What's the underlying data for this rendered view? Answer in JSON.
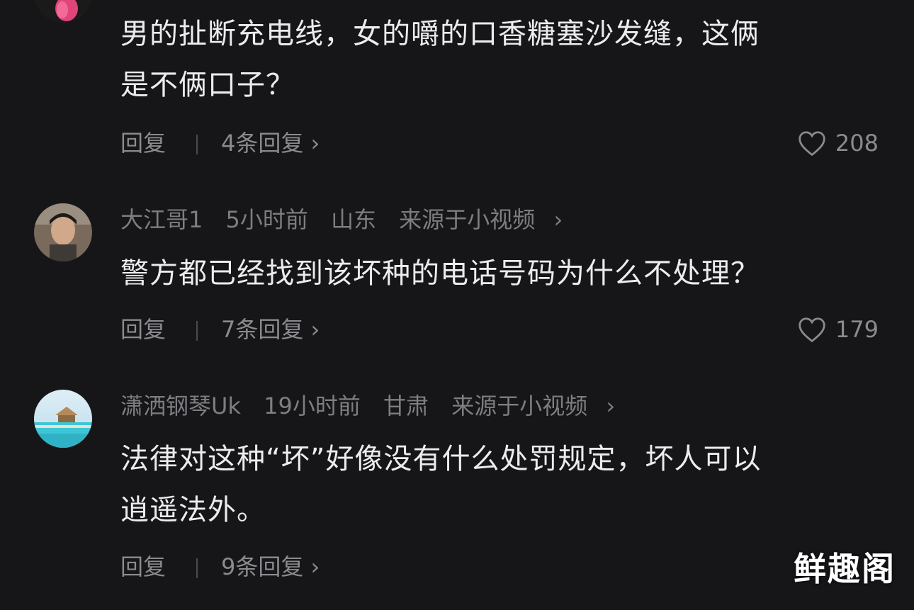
{
  "comments": [
    {
      "text_lines": [
        "男的扯断充电线，女的嚼的口香糖塞沙发缝，这俩",
        "是不俩口子？"
      ],
      "reply_label": "回复",
      "replies_label": "4条回复",
      "likes": "208"
    },
    {
      "username": "大江哥1",
      "time": "5小时前",
      "location": "山东",
      "source": "来源于小视频",
      "text_lines": [
        "警方都已经找到该坏种的电话号码为什么不处理？"
      ],
      "reply_label": "回复",
      "replies_label": "7条回复",
      "likes": "179"
    },
    {
      "username": "潇洒钢琴Uk",
      "time": "19小时前",
      "location": "甘肃",
      "source": "来源于小视频",
      "text_lines": [
        "法律对这种“坏”好像没有什么处罚规定，坏人可以",
        "逍遥法外。"
      ],
      "reply_label": "回复",
      "replies_label": "9条回复"
    }
  ],
  "watermark": "鲜趣阁",
  "chevron": "›"
}
